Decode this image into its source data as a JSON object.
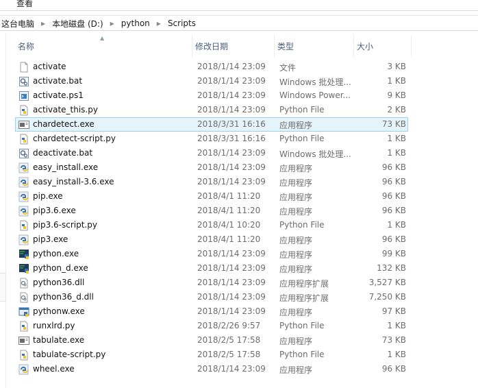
{
  "ribbon": {
    "view_tab": "查看"
  },
  "breadcrumb": [
    "这台电脑",
    "本地磁盘 (D:)",
    "python",
    "Scripts"
  ],
  "breadcrumb_separator": "▶",
  "columns": {
    "name": "名称",
    "date": "修改日期",
    "type": "类型",
    "size": "大小",
    "sort_indicator": "▲"
  },
  "colors": {
    "selection_bg": "#e5f3fb",
    "selection_border": "#99d1ee",
    "header_text": "#4c607a"
  },
  "files": [
    {
      "name": "activate",
      "date": "2018/1/14 23:09",
      "type": "文件",
      "size": "3 KB",
      "icon": "blank-file-icon"
    },
    {
      "name": "activate.bat",
      "date": "2018/1/14 23:09",
      "type": "Windows 批处理...",
      "size": "1 KB",
      "icon": "batch-file-icon"
    },
    {
      "name": "activate.ps1",
      "date": "2018/1/14 23:09",
      "type": "Windows Power...",
      "size": "9 KB",
      "icon": "powershell-file-icon"
    },
    {
      "name": "activate_this.py",
      "date": "2018/1/14 23:09",
      "type": "Python File",
      "size": "2 KB",
      "icon": "python-file-icon"
    },
    {
      "name": "chardetect.exe",
      "date": "2018/3/31 16:16",
      "type": "应用程序",
      "size": "73 KB",
      "icon": "console-app-icon",
      "selected": true
    },
    {
      "name": "chardetect-script.py",
      "date": "2018/3/31 16:16",
      "type": "Python File",
      "size": "1 KB",
      "icon": "python-file-icon"
    },
    {
      "name": "deactivate.bat",
      "date": "2018/1/14 23:09",
      "type": "Windows 批处理...",
      "size": "1 KB",
      "icon": "batch-file-icon"
    },
    {
      "name": "easy_install.exe",
      "date": "2018/1/14 23:09",
      "type": "应用程序",
      "size": "96 KB",
      "icon": "python-launcher-icon"
    },
    {
      "name": "easy_install-3.6.exe",
      "date": "2018/1/14 23:09",
      "type": "应用程序",
      "size": "96 KB",
      "icon": "python-launcher-icon"
    },
    {
      "name": "pip.exe",
      "date": "2018/4/1 11:20",
      "type": "应用程序",
      "size": "96 KB",
      "icon": "python-launcher-icon"
    },
    {
      "name": "pip3.6.exe",
      "date": "2018/4/1 11:20",
      "type": "应用程序",
      "size": "96 KB",
      "icon": "python-launcher-icon"
    },
    {
      "name": "pip3.6-script.py",
      "date": "2018/4/1 10:20",
      "type": "Python File",
      "size": "1 KB",
      "icon": "python-file-icon"
    },
    {
      "name": "pip3.exe",
      "date": "2018/4/1 11:20",
      "type": "应用程序",
      "size": "96 KB",
      "icon": "python-launcher-icon"
    },
    {
      "name": "python.exe",
      "date": "2018/1/14 23:09",
      "type": "应用程序",
      "size": "99 KB",
      "icon": "python-exe-icon"
    },
    {
      "name": "python_d.exe",
      "date": "2018/1/14 23:09",
      "type": "应用程序",
      "size": "132 KB",
      "icon": "python-exe-icon"
    },
    {
      "name": "python36.dll",
      "date": "2018/1/14 23:09",
      "type": "应用程序扩展",
      "size": "3,527 KB",
      "icon": "dll-file-icon"
    },
    {
      "name": "python36_d.dll",
      "date": "2018/1/14 23:09",
      "type": "应用程序扩展",
      "size": "7,250 KB",
      "icon": "dll-file-icon"
    },
    {
      "name": "pythonw.exe",
      "date": "2018/1/14 23:09",
      "type": "应用程序",
      "size": "97 KB",
      "icon": "pythonw-exe-icon"
    },
    {
      "name": "runxlrd.py",
      "date": "2018/2/26 9:57",
      "type": "Python File",
      "size": "1 KB",
      "icon": "python-file-icon"
    },
    {
      "name": "tabulate.exe",
      "date": "2018/2/5 17:58",
      "type": "应用程序",
      "size": "73 KB",
      "icon": "console-app-icon"
    },
    {
      "name": "tabulate-script.py",
      "date": "2018/2/5 17:58",
      "type": "Python File",
      "size": "1 KB",
      "icon": "python-file-icon"
    },
    {
      "name": "wheel.exe",
      "date": "2018/1/14 23:09",
      "type": "应用程序",
      "size": "96 KB",
      "icon": "python-launcher-icon"
    }
  ]
}
